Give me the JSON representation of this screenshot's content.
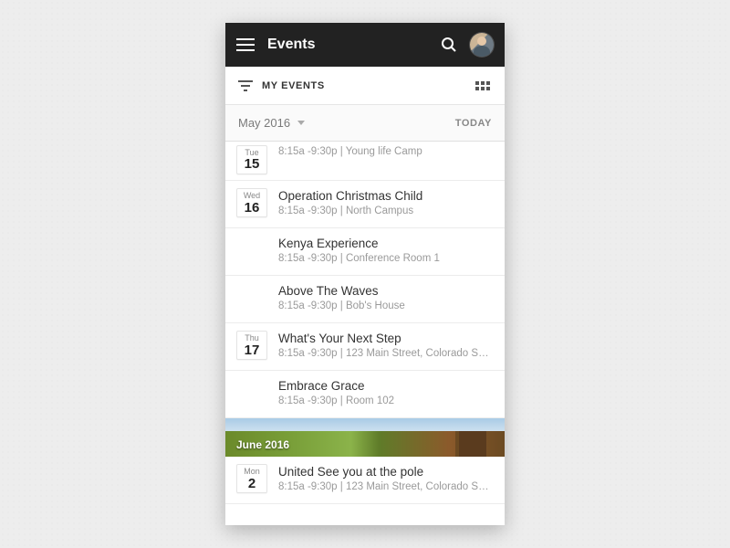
{
  "header": {
    "title": "Events"
  },
  "filter": {
    "label": "MY EVENTS"
  },
  "datebar": {
    "month": "May 2016",
    "today_label": "TODAY"
  },
  "events": [
    {
      "dow": "Tue",
      "dnum": "15",
      "show_chip": true,
      "title": "",
      "meta": "8:15a -9:30p | Young life Camp"
    },
    {
      "dow": "Wed",
      "dnum": "16",
      "show_chip": true,
      "title": "Operation Christmas Child",
      "meta": "8:15a -9:30p | North Campus"
    },
    {
      "dow": "",
      "dnum": "",
      "show_chip": false,
      "title": "Kenya Experience",
      "meta": "8:15a -9:30p | Conference Room 1"
    },
    {
      "dow": "",
      "dnum": "",
      "show_chip": false,
      "title": "Above The Waves",
      "meta": "8:15a -9:30p | Bob's House"
    },
    {
      "dow": "Thu",
      "dnum": "17",
      "show_chip": true,
      "title": "What's Your Next Step",
      "meta": "8:15a -9:30p | 123 Main Street, Colorado Spri…"
    },
    {
      "dow": "",
      "dnum": "",
      "show_chip": false,
      "title": "Embrace Grace",
      "meta": "8:15a -9:30p | Room 102"
    }
  ],
  "next_month": {
    "label": "June 2016"
  },
  "events_next": [
    {
      "dow": "Mon",
      "dnum": "2",
      "show_chip": true,
      "title": "United See you at the pole",
      "meta": "8:15a -9:30p | 123 Main Street, Colorado Spri…"
    }
  ]
}
